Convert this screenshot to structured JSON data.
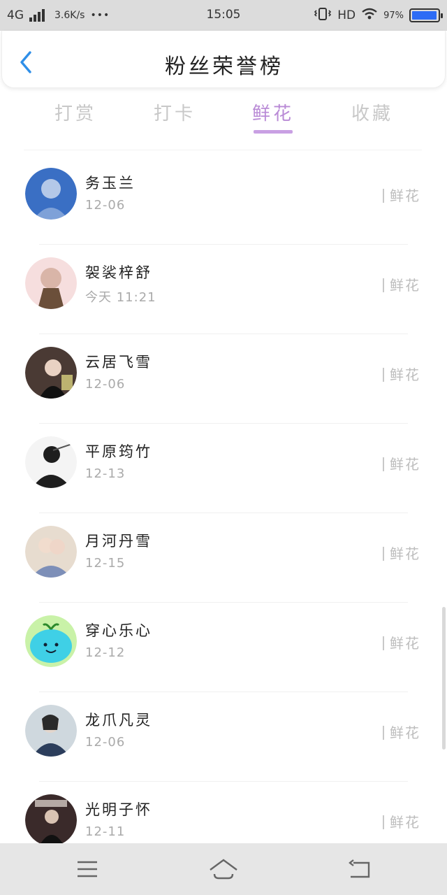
{
  "status_bar": {
    "network": "4G",
    "speed": "3.6K/s",
    "dots": "•••",
    "time": "15:05",
    "hd": "HD",
    "battery_text": "97%",
    "battery_level": 0.97,
    "icons": [
      "signal-icon",
      "vibrate-icon",
      "wifi-icon",
      "battery-icon"
    ]
  },
  "header": {
    "title": "粉丝荣誉榜",
    "back_icon": "chevron-left-icon"
  },
  "tabs": [
    {
      "label": "打赏",
      "active": false
    },
    {
      "label": "打卡",
      "active": false
    },
    {
      "label": "鲜花",
      "active": true
    },
    {
      "label": "收藏",
      "active": false
    }
  ],
  "fans": [
    {
      "name": "务玉兰",
      "date": "12-06",
      "gift": "鲜花",
      "avatar_color": "#3a6fc4"
    },
    {
      "name": "袈裟梓舒",
      "date": "今天 11:21",
      "gift": "鲜花",
      "avatar_color": "#d9b5a8"
    },
    {
      "name": "云居飞雪",
      "date": "12-06",
      "gift": "鲜花",
      "avatar_color": "#4a3a34"
    },
    {
      "name": "平原筠竹",
      "date": "12-13",
      "gift": "鲜花",
      "avatar_color": "#1e1e1e"
    },
    {
      "name": "月河丹雪",
      "date": "12-15",
      "gift": "鲜花",
      "avatar_color": "#7d8fb8"
    },
    {
      "name": "穿心乐心",
      "date": "12-12",
      "gift": "鲜花",
      "avatar_color": "#3fd0e6"
    },
    {
      "name": "龙爪凡灵",
      "date": "12-06",
      "gift": "鲜花",
      "avatar_color": "#2c3e5c"
    },
    {
      "name": "光明子怀",
      "date": "12-11",
      "gift": "鲜花",
      "avatar_color": "#3a2a2a"
    }
  ],
  "colors": {
    "accent": "#b98ad6",
    "underline": "#c9a0e3",
    "back_arrow": "#2f8fe8"
  },
  "navbar": {
    "icons": [
      "menu-icon",
      "home-icon",
      "back-icon"
    ]
  }
}
